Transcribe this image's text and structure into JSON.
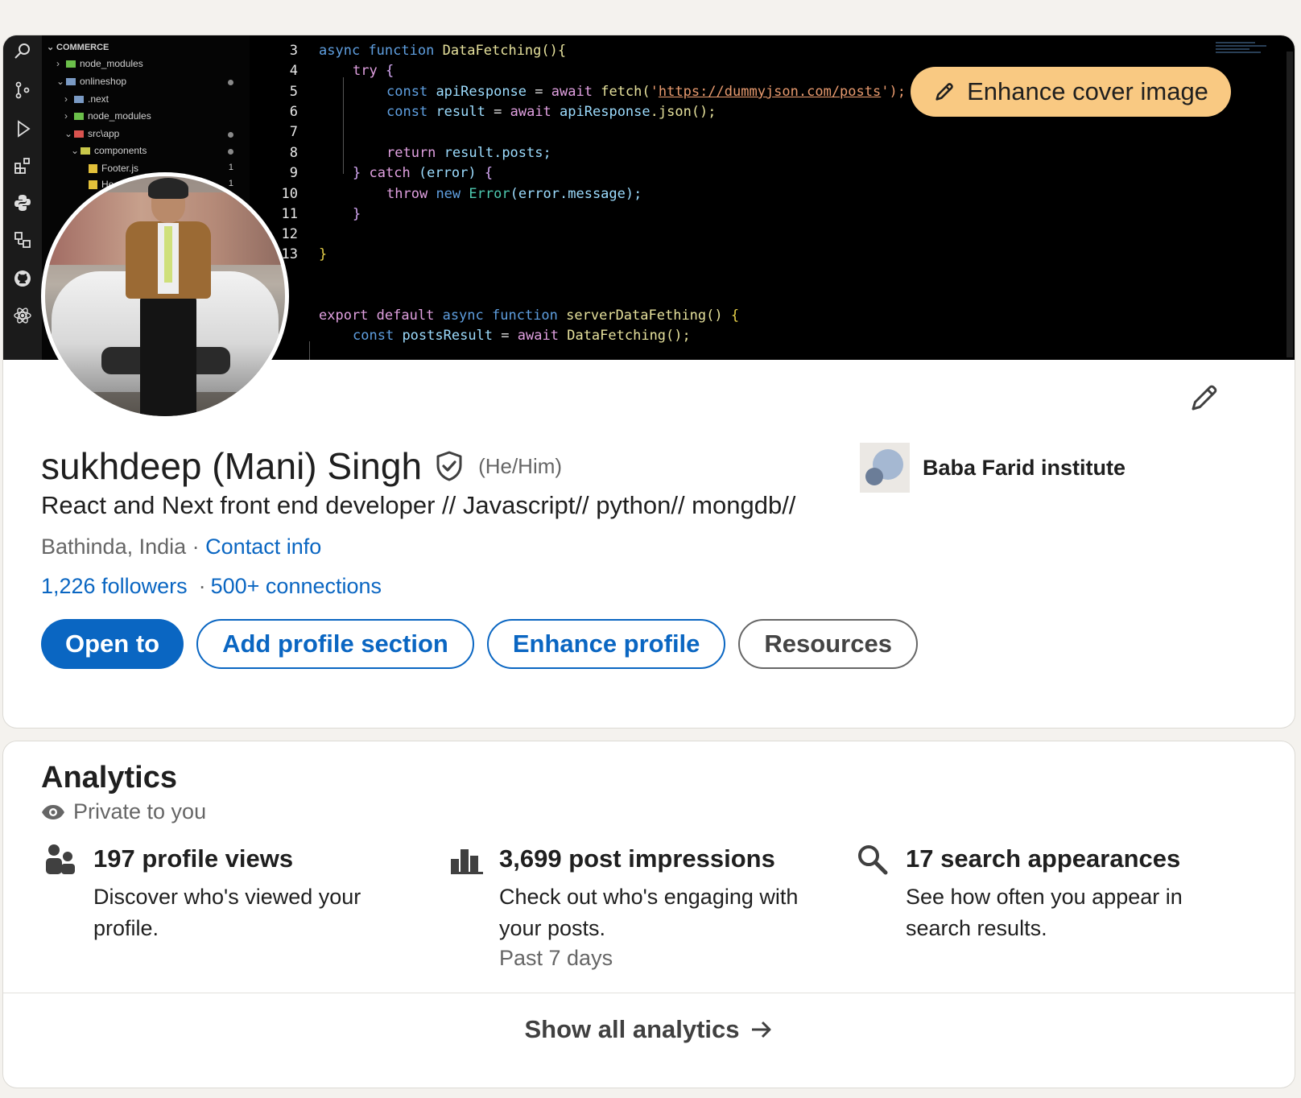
{
  "cover": {
    "explorer": {
      "root": "COMMERCE",
      "items": [
        {
          "label": "node_modules"
        },
        {
          "label": "onlineshop"
        },
        {
          "label": ".next"
        },
        {
          "label": "node_modules"
        },
        {
          "label": "src\\app"
        },
        {
          "label": "components"
        },
        {
          "label": "Footer.js",
          "badge": "1"
        },
        {
          "label": "He",
          "badge": "1"
        }
      ]
    },
    "code": {
      "line_numbers": [
        "3",
        "4",
        "5",
        "6",
        "7",
        "8",
        "9",
        "10",
        "11",
        "12",
        "13"
      ],
      "lines": {
        "l3_kw1": "async",
        "l3_kw2": "function",
        "l3_fn": "DataFetching(){",
        "l4_kw": "try",
        "l4_br": "{",
        "l5_kw": "const",
        "l5_var": "apiResponse",
        "l5_op": "=",
        "l5_await": "await",
        "l5_fn": "fetch(",
        "l5_q1": "'",
        "l5_url": "https://dummyjson.com/posts",
        "l5_q2": "');",
        "l6_kw": "const",
        "l6_var": "result",
        "l6_op": "=",
        "l6_await": "await",
        "l6_obj": "apiResponse",
        "l6_fn": ".json();",
        "l8_kw": "return",
        "l8_var": "result.posts;",
        "l9_br1": "}",
        "l9_kw": "catch",
        "l9_arg": "(error)",
        "l9_br2": "{",
        "l10_kw": "throw",
        "l10_new": "new",
        "l10_cls": "Error",
        "l10_arg": "(error.message);",
        "l11_br": "}",
        "l13_br": "}",
        "l16_kw1": "export",
        "l16_kw2": "default",
        "l16_kw3": "async",
        "l16_kw4": "function",
        "l16_fn": "serverDataFething()",
        "l16_br": "{",
        "l17_kw": "const",
        "l17_var": "postsResult",
        "l17_op": "=",
        "l17_await": "await",
        "l17_fn": "DataFetching();"
      }
    },
    "enhance_cover_label": "Enhance cover image"
  },
  "profile": {
    "name": "sukhdeep (Mani) Singh",
    "pronouns": "(He/Him)",
    "headline": "React and Next front end developer // Javascript// python// mongdb//",
    "location": "Bathinda, India",
    "location_sep": "·",
    "contact_info": "Contact info",
    "followers": "1,226 followers",
    "connections_sep": "·",
    "connections": "500+ connections",
    "education": "Baba Farid institute",
    "buttons": {
      "open_to": "Open to",
      "add_section": "Add profile section",
      "enhance_profile": "Enhance profile",
      "resources": "Resources"
    }
  },
  "analytics": {
    "title": "Analytics",
    "privacy": "Private to you",
    "metrics": [
      {
        "title": "197 profile views",
        "desc": "Discover who's viewed your profile.",
        "icon": "people-icon"
      },
      {
        "title": "3,699 post impressions",
        "desc": "Check out who's engaging with your posts.",
        "sub": "Past 7 days",
        "icon": "bar-chart-icon"
      },
      {
        "title": "17 search appearances",
        "desc": "See how often you appear in search results.",
        "icon": "search-icon"
      }
    ],
    "show_all": "Show all analytics"
  },
  "colors": {
    "brand_blue": "#0a66c2",
    "cover_button": "#f9c982",
    "page_bg": "#f4f2ee"
  }
}
